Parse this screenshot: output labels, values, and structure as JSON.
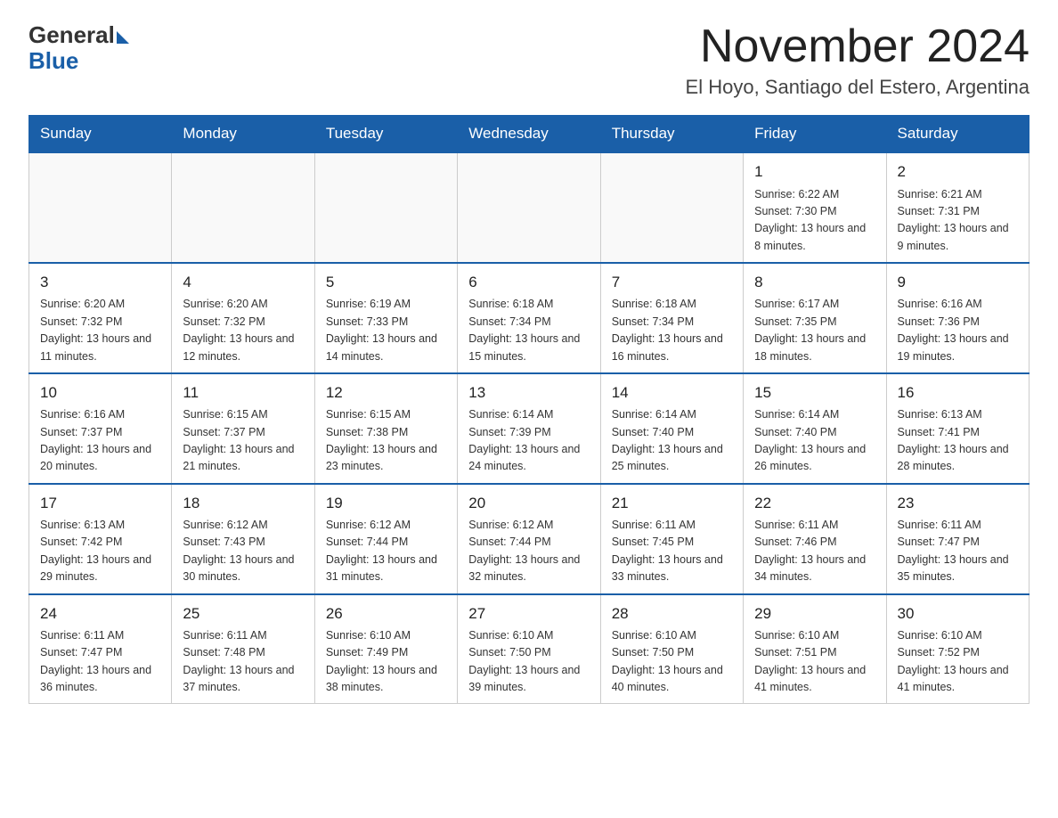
{
  "logo": {
    "general": "General",
    "blue": "Blue"
  },
  "title": "November 2024",
  "location": "El Hoyo, Santiago del Estero, Argentina",
  "weekdays": [
    "Sunday",
    "Monday",
    "Tuesday",
    "Wednesday",
    "Thursday",
    "Friday",
    "Saturday"
  ],
  "weeks": [
    [
      {
        "day": "",
        "info": ""
      },
      {
        "day": "",
        "info": ""
      },
      {
        "day": "",
        "info": ""
      },
      {
        "day": "",
        "info": ""
      },
      {
        "day": "",
        "info": ""
      },
      {
        "day": "1",
        "info": "Sunrise: 6:22 AM\nSunset: 7:30 PM\nDaylight: 13 hours and 8 minutes."
      },
      {
        "day": "2",
        "info": "Sunrise: 6:21 AM\nSunset: 7:31 PM\nDaylight: 13 hours and 9 minutes."
      }
    ],
    [
      {
        "day": "3",
        "info": "Sunrise: 6:20 AM\nSunset: 7:32 PM\nDaylight: 13 hours and 11 minutes."
      },
      {
        "day": "4",
        "info": "Sunrise: 6:20 AM\nSunset: 7:32 PM\nDaylight: 13 hours and 12 minutes."
      },
      {
        "day": "5",
        "info": "Sunrise: 6:19 AM\nSunset: 7:33 PM\nDaylight: 13 hours and 14 minutes."
      },
      {
        "day": "6",
        "info": "Sunrise: 6:18 AM\nSunset: 7:34 PM\nDaylight: 13 hours and 15 minutes."
      },
      {
        "day": "7",
        "info": "Sunrise: 6:18 AM\nSunset: 7:34 PM\nDaylight: 13 hours and 16 minutes."
      },
      {
        "day": "8",
        "info": "Sunrise: 6:17 AM\nSunset: 7:35 PM\nDaylight: 13 hours and 18 minutes."
      },
      {
        "day": "9",
        "info": "Sunrise: 6:16 AM\nSunset: 7:36 PM\nDaylight: 13 hours and 19 minutes."
      }
    ],
    [
      {
        "day": "10",
        "info": "Sunrise: 6:16 AM\nSunset: 7:37 PM\nDaylight: 13 hours and 20 minutes."
      },
      {
        "day": "11",
        "info": "Sunrise: 6:15 AM\nSunset: 7:37 PM\nDaylight: 13 hours and 21 minutes."
      },
      {
        "day": "12",
        "info": "Sunrise: 6:15 AM\nSunset: 7:38 PM\nDaylight: 13 hours and 23 minutes."
      },
      {
        "day": "13",
        "info": "Sunrise: 6:14 AM\nSunset: 7:39 PM\nDaylight: 13 hours and 24 minutes."
      },
      {
        "day": "14",
        "info": "Sunrise: 6:14 AM\nSunset: 7:40 PM\nDaylight: 13 hours and 25 minutes."
      },
      {
        "day": "15",
        "info": "Sunrise: 6:14 AM\nSunset: 7:40 PM\nDaylight: 13 hours and 26 minutes."
      },
      {
        "day": "16",
        "info": "Sunrise: 6:13 AM\nSunset: 7:41 PM\nDaylight: 13 hours and 28 minutes."
      }
    ],
    [
      {
        "day": "17",
        "info": "Sunrise: 6:13 AM\nSunset: 7:42 PM\nDaylight: 13 hours and 29 minutes."
      },
      {
        "day": "18",
        "info": "Sunrise: 6:12 AM\nSunset: 7:43 PM\nDaylight: 13 hours and 30 minutes."
      },
      {
        "day": "19",
        "info": "Sunrise: 6:12 AM\nSunset: 7:44 PM\nDaylight: 13 hours and 31 minutes."
      },
      {
        "day": "20",
        "info": "Sunrise: 6:12 AM\nSunset: 7:44 PM\nDaylight: 13 hours and 32 minutes."
      },
      {
        "day": "21",
        "info": "Sunrise: 6:11 AM\nSunset: 7:45 PM\nDaylight: 13 hours and 33 minutes."
      },
      {
        "day": "22",
        "info": "Sunrise: 6:11 AM\nSunset: 7:46 PM\nDaylight: 13 hours and 34 minutes."
      },
      {
        "day": "23",
        "info": "Sunrise: 6:11 AM\nSunset: 7:47 PM\nDaylight: 13 hours and 35 minutes."
      }
    ],
    [
      {
        "day": "24",
        "info": "Sunrise: 6:11 AM\nSunset: 7:47 PM\nDaylight: 13 hours and 36 minutes."
      },
      {
        "day": "25",
        "info": "Sunrise: 6:11 AM\nSunset: 7:48 PM\nDaylight: 13 hours and 37 minutes."
      },
      {
        "day": "26",
        "info": "Sunrise: 6:10 AM\nSunset: 7:49 PM\nDaylight: 13 hours and 38 minutes."
      },
      {
        "day": "27",
        "info": "Sunrise: 6:10 AM\nSunset: 7:50 PM\nDaylight: 13 hours and 39 minutes."
      },
      {
        "day": "28",
        "info": "Sunrise: 6:10 AM\nSunset: 7:50 PM\nDaylight: 13 hours and 40 minutes."
      },
      {
        "day": "29",
        "info": "Sunrise: 6:10 AM\nSunset: 7:51 PM\nDaylight: 13 hours and 41 minutes."
      },
      {
        "day": "30",
        "info": "Sunrise: 6:10 AM\nSunset: 7:52 PM\nDaylight: 13 hours and 41 minutes."
      }
    ]
  ]
}
